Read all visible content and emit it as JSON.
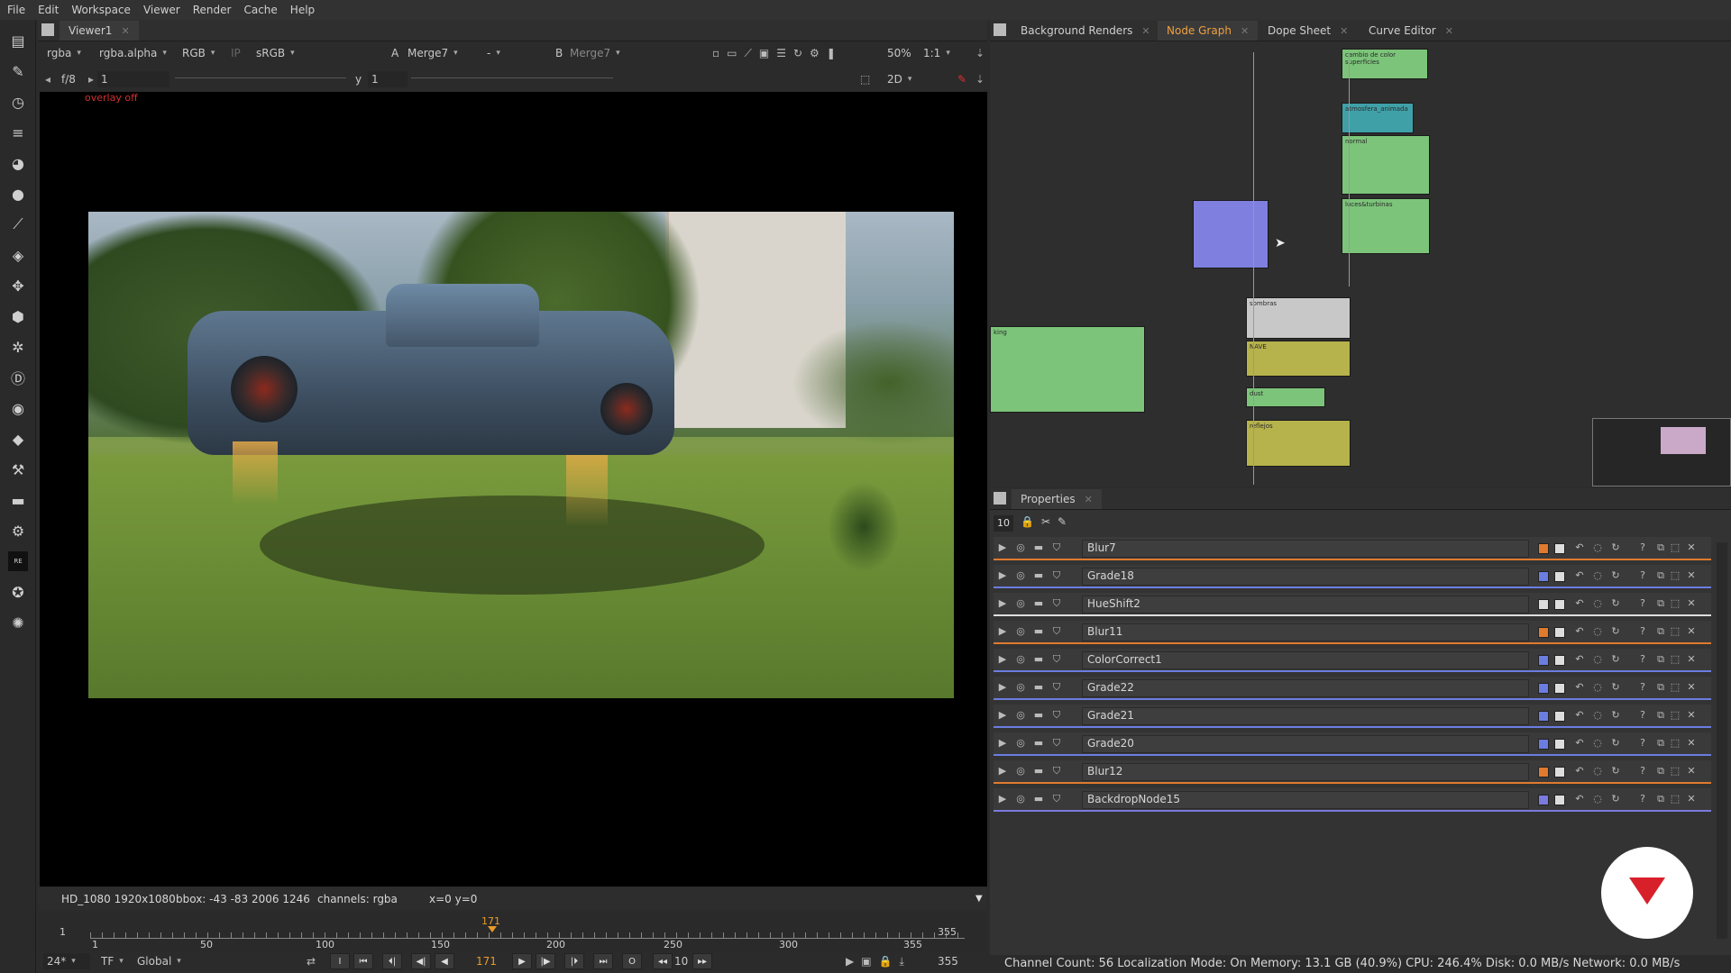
{
  "menu": [
    "File",
    "Edit",
    "Workspace",
    "Viewer",
    "Render",
    "Cache",
    "Help"
  ],
  "viewer": {
    "tab_label": "Viewer1",
    "channels": "rgba",
    "alpha_channel": "rgba.alpha",
    "colorspace_rgb": "RGB",
    "ip_label": "IP",
    "viewer_lut": "sRGB",
    "input_a_label": "A",
    "input_a": "Merge7",
    "compare_mode": "-",
    "input_b_label": "B",
    "input_b": "Merge7",
    "zoom": "50%",
    "ratio": "1:1",
    "fstop": "f/8",
    "gain": "1",
    "gamma_label": "y",
    "gamma": "1",
    "view_mode": "2D",
    "overlay_text": "overlay off",
    "status_format": "HD_1080 1920x1080",
    "status_bbox": "bbox: -43 -83 2006 1246",
    "status_channels": "channels: rgba",
    "status_coords": "x=0 y=0"
  },
  "timeline": {
    "start": "1",
    "end": "355",
    "current": "171",
    "ticks": [
      "1",
      "50",
      "100",
      "150",
      "200",
      "250",
      "300",
      "355"
    ],
    "fps": "24*",
    "tf_label": "TF",
    "global_label": "Global",
    "step": "10",
    "end_frame_field": "355"
  },
  "panels": {
    "tabs": [
      {
        "label": "Background Renders",
        "active": false
      },
      {
        "label": "Node Graph",
        "active": true
      },
      {
        "label": "Dope Sheet",
        "active": false
      },
      {
        "label": "Curve Editor",
        "active": false
      }
    ],
    "properties_tab": "Properties",
    "properties_count": "10"
  },
  "node_labels": {
    "cambio": "cambio de color superficies",
    "atmosfera": "atmosfera_animada",
    "normal": "normal",
    "luces": "luces&turbinas",
    "sombras": "sombras",
    "nave": "NAVE",
    "dust": "dust",
    "reflejos": "reflejos",
    "tracking": "king"
  },
  "properties": [
    {
      "name": "Blur7",
      "color": "#e07a2e"
    },
    {
      "name": "Grade18",
      "color": "#6b7de0"
    },
    {
      "name": "HueShift2",
      "color": "#dddddd"
    },
    {
      "name": "Blur11",
      "color": "#e07a2e"
    },
    {
      "name": "ColorCorrect1",
      "color": "#6b7de0"
    },
    {
      "name": "Grade22",
      "color": "#6b7de0"
    },
    {
      "name": "Grade21",
      "color": "#6b7de0"
    },
    {
      "name": "Grade20",
      "color": "#6b7de0"
    },
    {
      "name": "Blur12",
      "color": "#e07a2e"
    },
    {
      "name": "BackdropNode15",
      "color": "#7a7ae0"
    }
  ],
  "status_bar": "Channel Count: 56 Localization Mode: On Memory: 13.1 GB (40.9%) CPU: 246.4% Disk: 0.0 MB/s Network: 0.0 MB/s"
}
